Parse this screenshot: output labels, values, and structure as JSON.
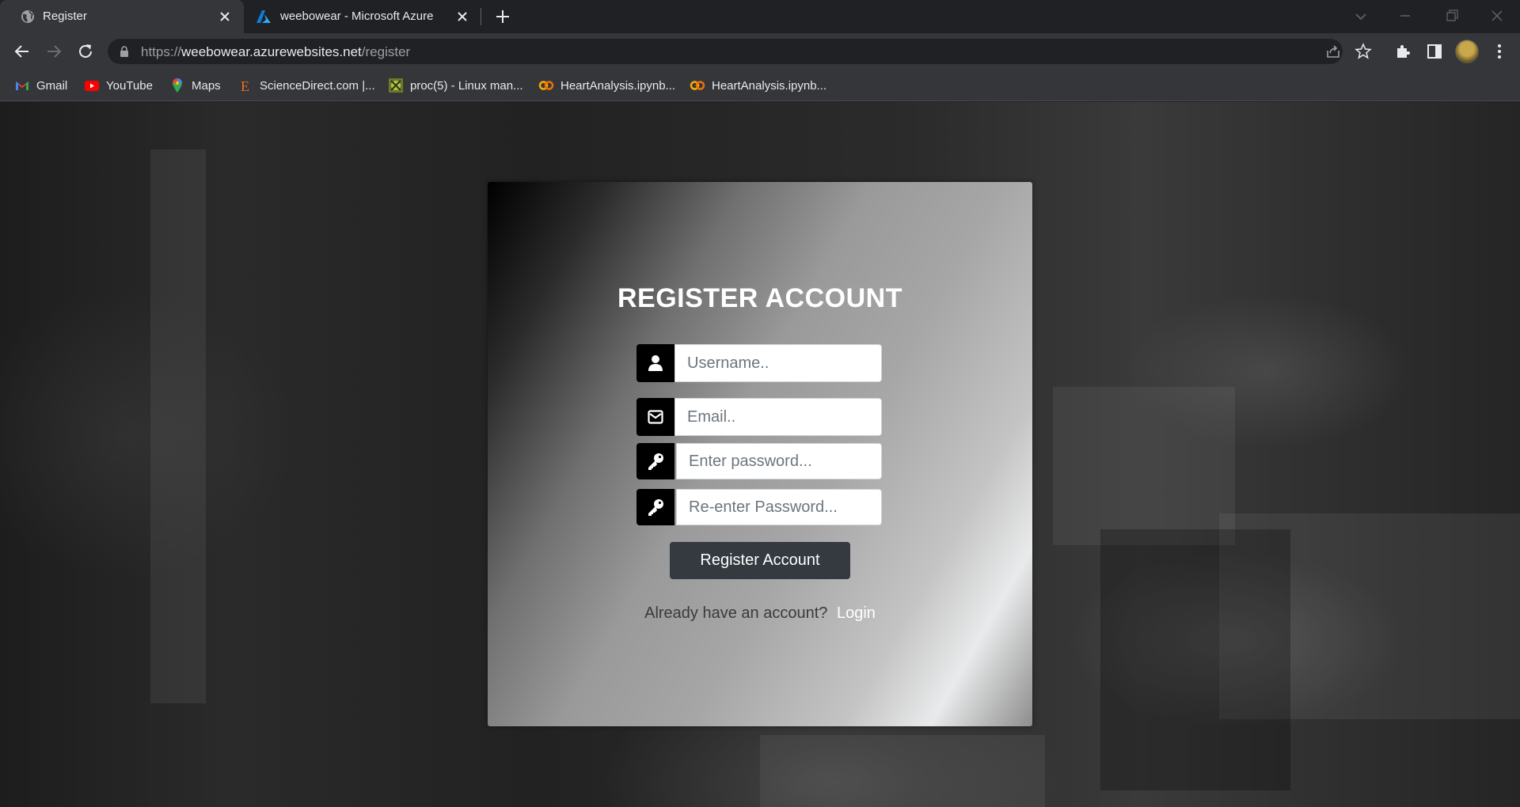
{
  "browser": {
    "tabs": [
      {
        "title": "Register",
        "active": true,
        "favicon": "globe-icon"
      },
      {
        "title": "weebowear - Microsoft Azure",
        "active": false,
        "favicon": "azure-icon"
      }
    ],
    "url": {
      "scheme": "https://",
      "host": "weebowear.azurewebsites.net",
      "path": "/register"
    },
    "bookmarks": [
      {
        "label": "Gmail",
        "icon": "gmail-icon"
      },
      {
        "label": "YouTube",
        "icon": "youtube-icon"
      },
      {
        "label": "Maps",
        "icon": "maps-icon"
      },
      {
        "label": "ScienceDirect.com |...",
        "icon": "sciencedirect-icon"
      },
      {
        "label": "proc(5) - Linux man...",
        "icon": "linux-man-icon"
      },
      {
        "label": "HeartAnalysis.ipynb...",
        "icon": "colab-icon"
      },
      {
        "label": "HeartAnalysis.ipynb...",
        "icon": "colab-icon"
      }
    ]
  },
  "form": {
    "title": "REGISTER ACCOUNT",
    "username_placeholder": "Username..",
    "email_placeholder": "Email..",
    "password_placeholder": "Enter password...",
    "repassword_placeholder": "Re-enter Password...",
    "submit_label": "Register Account",
    "login_prompt": "Already have an account?",
    "login_link": "Login"
  },
  "colors": {
    "button": "#343a40",
    "icon_box": "#000000",
    "chrome_dark": "#202124",
    "chrome_toolbar": "#35363a"
  }
}
